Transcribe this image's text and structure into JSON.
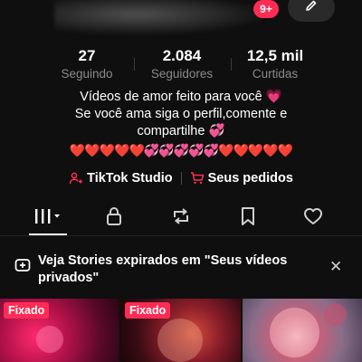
{
  "header": {
    "notification_count": "9+",
    "edit_icon": "pencil-icon",
    "accent_color": "#fe2c55"
  },
  "stats": [
    {
      "value": "27",
      "label": "Seguindo"
    },
    {
      "value": "2.084",
      "label": "Seguidores"
    },
    {
      "value": "12,5 mil",
      "label": "Curtidas"
    }
  ],
  "bio": {
    "line1": "Vídeos de amor feito para você 💗",
    "line2": "Se você ama siga o perfil,comente e",
    "line3": "compartilhe 💞",
    "hearts": "❤️❤️❤️❤️❤️💞💞💞💞💞❤️❤️❤️❤️❤️"
  },
  "actions": {
    "studio_label": "TikTok Studio",
    "studio_icon": "person-plus-icon",
    "orders_label": "Seus pedidos",
    "orders_icon": "cart-icon"
  },
  "tabs": [
    {
      "name": "videos-grid",
      "icon": "grid-icon",
      "active": true
    },
    {
      "name": "private",
      "icon": "lock-icon"
    },
    {
      "name": "reposts",
      "icon": "repost-icon"
    },
    {
      "name": "favorites",
      "icon": "bookmark-icon"
    },
    {
      "name": "liked",
      "icon": "heart-icon"
    }
  ],
  "stories_banner": {
    "text": "Veja Stories expirados em \"Seus vídeos privados\"",
    "icon": "add-story-icon",
    "close_icon": "close-icon"
  },
  "videos": [
    {
      "badge": "Fixado"
    },
    {
      "badge": "Fixado"
    },
    {
      "badge": ""
    }
  ]
}
